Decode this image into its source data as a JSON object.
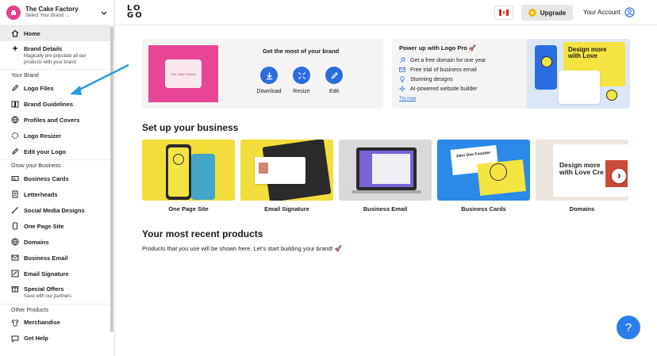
{
  "brand": {
    "name": "The Cake Factory",
    "sub": "Select Your Brand →"
  },
  "sidebar": {
    "home": "Home",
    "brand_details": {
      "label": "Brand Details",
      "desc": "Magically pre-populate all our products with your brand"
    },
    "your_brand_label": "Your Brand",
    "your_brand": [
      "Logo Files",
      "Brand Guidelines",
      "Profiles and Covers",
      "Logo Resizer",
      "Edit your Logo"
    ],
    "grow_label": "Grow your Business",
    "grow": [
      "Business Cards",
      "Letterheads",
      "Social Media Designs",
      "One Page Site",
      "Domains",
      "Business Email",
      "Email Signature"
    ],
    "special_offers": {
      "label": "Special Offers",
      "desc": "Save with our partners"
    },
    "other_label": "Other Products",
    "other": [
      "Merchandise",
      "Get Help"
    ]
  },
  "topbar": {
    "logo": "LOGO",
    "upgrade": "Upgrade",
    "account": "Your Account"
  },
  "brand_card": {
    "title": "Get the most of your brand",
    "logo_text": "The Cake Factory",
    "actions": [
      "Download",
      "Resize",
      "Edit"
    ]
  },
  "promo": {
    "title": "Power up with Logo Pro 🚀",
    "features": [
      "Get a free domain for one year",
      "Free trial of business email",
      "Stunning designs",
      "AI-powered website builder"
    ],
    "cta": "Try now",
    "art_text": "Design more with Love"
  },
  "setup": {
    "title": "Set up your business",
    "tiles": [
      "One Page Site",
      "Email Signature",
      "Business Email",
      "Business Cards",
      "Domains"
    ],
    "card_text": "John Doe Founder",
    "domains_text": "Design more with Love Cre"
  },
  "recent": {
    "title": "Your most recent products",
    "text": "Products that you use will be shown here. Let’s start building your brand! 🚀"
  },
  "help": "?",
  "colors": {
    "accent": "#2b6ce0",
    "brand_pink": "#e64694",
    "yellow": "#f4e442",
    "arrow": "#2a9be0"
  }
}
